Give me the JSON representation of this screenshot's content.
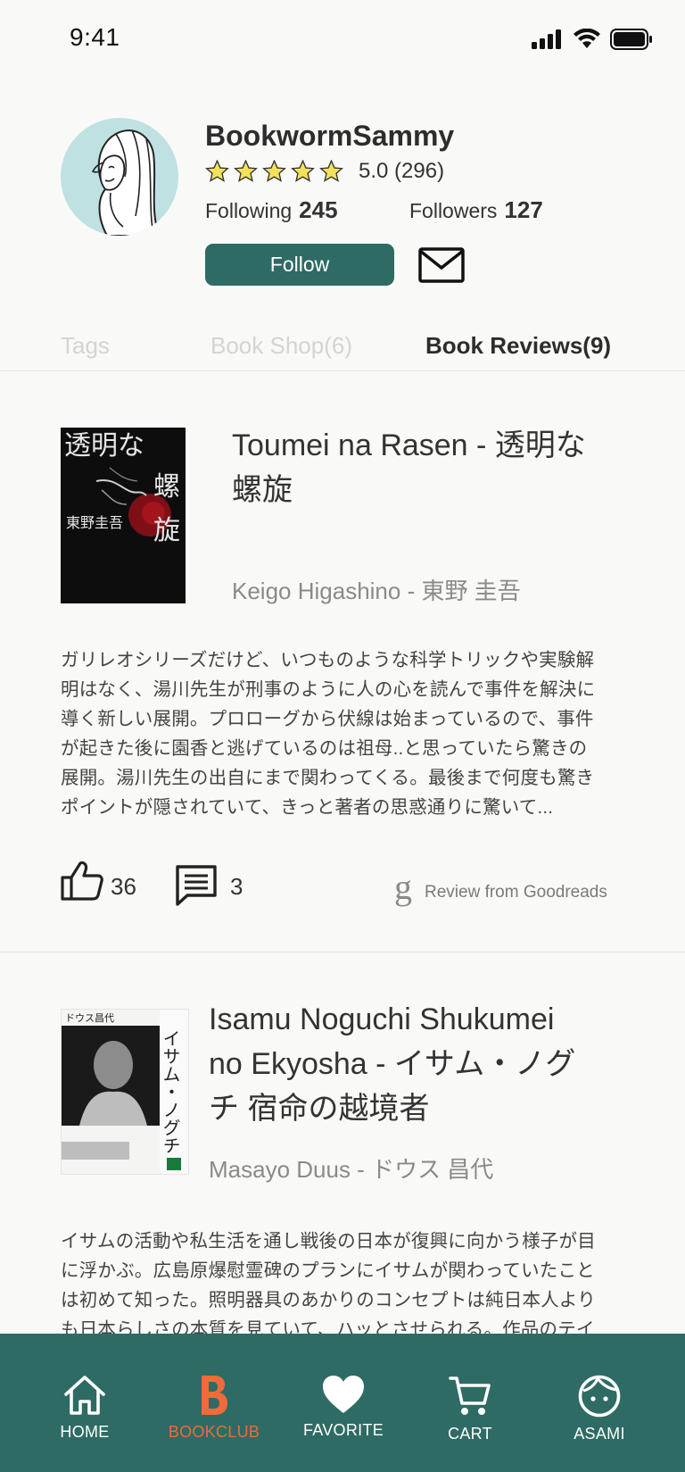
{
  "status_bar": {
    "time": "9:41"
  },
  "profile": {
    "username": "BookwormSammy",
    "rating": "5.0 (296)",
    "stars_filled": 5,
    "following_label": "Following",
    "following_count": "245",
    "followers_label": "Followers",
    "followers_count": "127",
    "follow_button": "Follow"
  },
  "tabs": [
    {
      "label": "Tags",
      "active": false
    },
    {
      "label": "Book Shop(6)",
      "active": false
    },
    {
      "label": "Book Reviews(9)",
      "active": true
    }
  ],
  "reviews": [
    {
      "title_line1": "Toumei na Rasen - 透明な",
      "title_line2": "螺旋",
      "author": "Keigo Higashino - 東野 圭吾",
      "cover_text": [
        "透明な",
        "螺",
        "旋",
        "東野圭吾"
      ],
      "text_lines": [
        "ガリレオシリーズだけど、いつものような科学トリックや実験解",
        "明はなく、湯川先生が刑事のように人の心を読んで事件を解決に",
        "導く新しい展開。プロローグから伏線は始まっているので、事件",
        "が起きた後に園香と逃げているのは祖母..と思っていたら驚きの",
        "展開。湯川先生の出自にまで関わってくる。最後まで何度も驚き",
        "ポイントが隠されていて、きっと著者の思惑通りに驚いて..."
      ],
      "likes": "36",
      "comments": "3",
      "source_letter": "g",
      "source": "Review from Goodreads"
    },
    {
      "title_line1": "Isamu Noguchi Shukumei",
      "title_line2": "no Ekyosha - イサム・ノグ",
      "title_line3": "チ 宿命の越境者",
      "author": "Masayo Duus - ドウス 昌代",
      "cover_text": [
        "ドウス昌代",
        "イサム・ノグチ"
      ],
      "text_lines": [
        "イサムの活動や私生活を通し戦後の日本が復興に向かう様子が目",
        "に浮かぶ。広島原爆慰霊碑のプランにイサムが関わっていたこと",
        "は初めて知った。照明器具のあかりのコンセプトは純日本人より",
        "も日本らしさの本質を見ていて、ハッとさせられる。作品のテイ"
      ]
    }
  ],
  "bottom_nav": [
    {
      "label": "HOME",
      "icon": "home-icon",
      "active": false
    },
    {
      "label": "BOOKCLUB",
      "icon": "bookclub-b-icon",
      "active": true
    },
    {
      "label": "FAVORITE",
      "icon": "heart-icon",
      "active": false
    },
    {
      "label": "CART",
      "icon": "cart-icon",
      "active": false
    },
    {
      "label": "ASAMI",
      "icon": "face-icon",
      "active": false
    }
  ],
  "colors": {
    "primary": "#2e6b64",
    "accent": "#f06a3a",
    "star": "#f2e25a",
    "avatar_bg": "#bfe1e2"
  }
}
